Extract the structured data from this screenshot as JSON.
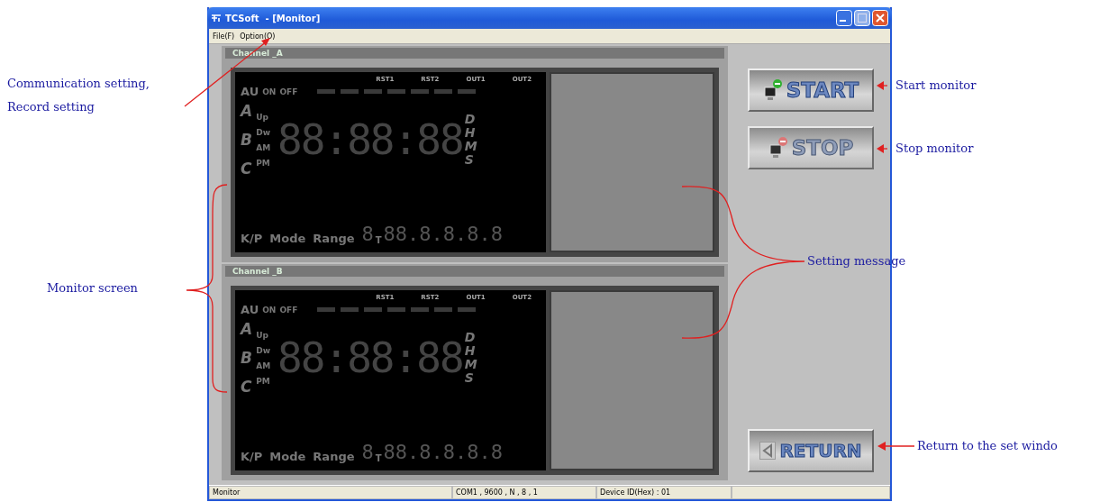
{
  "window": {
    "title": "TCSoft  - [Monitor]"
  },
  "menu": [
    {
      "label": "File(F)"
    },
    {
      "label": "Option(O)"
    }
  ],
  "channels": [
    {
      "title": "Channel _A",
      "top_labels": [
        "RST1",
        "RST2",
        "OUT1",
        "OUT2"
      ],
      "mode_labels": [
        "AU",
        "ON",
        "OFF"
      ],
      "group_labels": [
        "A",
        "B",
        "C"
      ],
      "small_labels": [
        "Up",
        "Dw",
        "AM",
        "PM"
      ],
      "digits": "88:88:88",
      "units": [
        "D",
        "H",
        "M",
        "S"
      ],
      "bottom_labels": [
        "K/P",
        "Mode",
        "Range"
      ],
      "sub_prefix": "8",
      "sub_marker": "T",
      "sub_digits": "88.8.8.8.8"
    },
    {
      "title": "Channel _B",
      "top_labels": [
        "RST1",
        "RST2",
        "OUT1",
        "OUT2"
      ],
      "mode_labels": [
        "AU",
        "ON",
        "OFF"
      ],
      "group_labels": [
        "A",
        "B",
        "C"
      ],
      "small_labels": [
        "Up",
        "Dw",
        "AM",
        "PM"
      ],
      "digits": "88:88:88",
      "units": [
        "D",
        "H",
        "M",
        "S"
      ],
      "bottom_labels": [
        "K/P",
        "Mode",
        "Range"
      ],
      "sub_prefix": "8",
      "sub_marker": "T",
      "sub_digits": "88.8.8.8.8"
    }
  ],
  "buttons": [
    {
      "label": "START",
      "kind": "start",
      "disabled": false
    },
    {
      "label": "STOP",
      "kind": "stop",
      "disabled": true
    },
    {
      "label": "RETURN",
      "kind": "return",
      "disabled": false
    }
  ],
  "status_bar": [
    "Monitor",
    "COM1 , 9600 , N , 8 , 1",
    "Device ID(Hex) : 01"
  ],
  "annotations": [
    {
      "kind": "option",
      "lines": [
        "Communication setting,",
        "Record setting"
      ]
    },
    {
      "kind": "screen",
      "lines": [
        "Monitor screen"
      ]
    },
    {
      "kind": "message",
      "lines": [
        "Setting message"
      ]
    },
    {
      "kind": "start",
      "lines": [
        "Start monitor"
      ]
    },
    {
      "kind": "stop",
      "lines": [
        "Stop monitor"
      ]
    },
    {
      "kind": "return",
      "lines": [
        "Return to the set windo"
      ]
    }
  ]
}
